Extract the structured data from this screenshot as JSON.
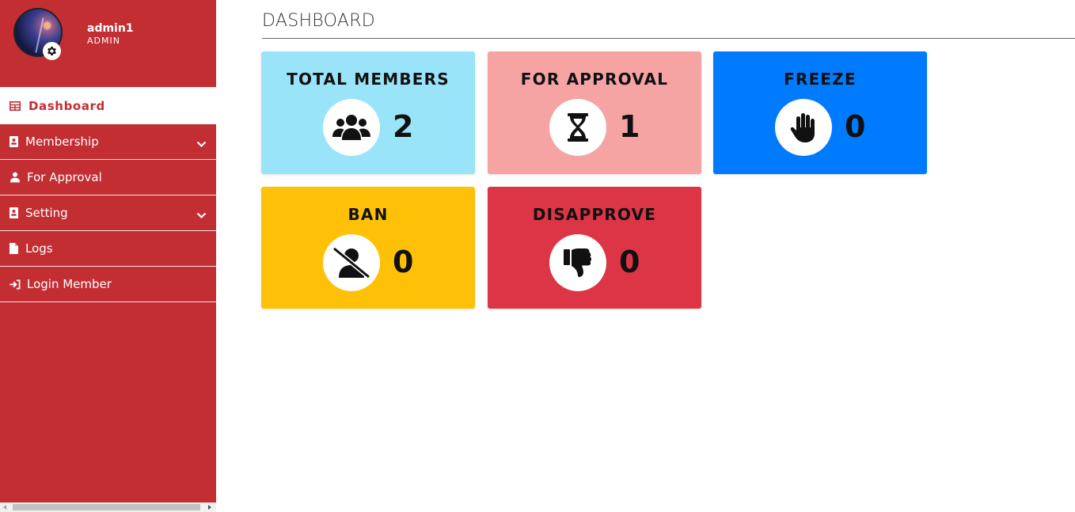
{
  "user": {
    "name": "admin1",
    "role": "ADMIN"
  },
  "sidebar": {
    "items": [
      {
        "label": "Dashboard",
        "icon": "table-icon",
        "active": true
      },
      {
        "label": "Membership",
        "icon": "id-card-icon",
        "has_dropdown": true
      },
      {
        "label": "For Approval",
        "icon": "user-icon"
      },
      {
        "label": "Setting",
        "icon": "id-card-icon",
        "has_dropdown": true
      },
      {
        "label": "Logs",
        "icon": "file-icon"
      },
      {
        "label": "Login Member",
        "icon": "sign-in-icon"
      }
    ]
  },
  "main": {
    "title": "DASHBOARD",
    "cards": [
      {
        "title": "TOTAL MEMBERS",
        "count": "2",
        "icon": "users-icon",
        "color": "#99e4f8"
      },
      {
        "title": "FOR APPROVAL",
        "count": "1",
        "icon": "hourglass-icon",
        "color": "#f5a3a3"
      },
      {
        "title": "FREEZE",
        "count": "0",
        "icon": "hand-icon",
        "color": "#007bff"
      },
      {
        "title": "BAN",
        "count": "0",
        "icon": "user-slash-icon",
        "color": "#ffc107"
      },
      {
        "title": "DISAPPROVE",
        "count": "0",
        "icon": "thumbs-down-icon",
        "color": "#dc3545"
      }
    ]
  },
  "colors": {
    "sidebar": "#c32e33",
    "accent": "#c32e33"
  }
}
